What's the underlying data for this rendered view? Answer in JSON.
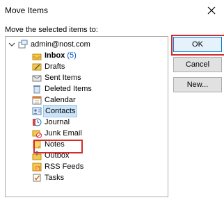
{
  "window": {
    "title": "Move Items"
  },
  "prompt": "Move the selected items to:",
  "tree": {
    "root": {
      "label": "admin@nost.com",
      "icon": "mailbox-icon"
    },
    "items": [
      {
        "label": "Inbox",
        "count": "(5)",
        "icon": "inbox-icon",
        "bold": true
      },
      {
        "label": "Drafts",
        "icon": "drafts-icon"
      },
      {
        "label": "Sent Items",
        "icon": "sent-items-icon"
      },
      {
        "label": "Deleted Items",
        "icon": "deleted-items-icon"
      },
      {
        "label": "Calendar",
        "icon": "calendar-icon"
      },
      {
        "label": "Contacts",
        "icon": "contacts-icon",
        "selected": true
      },
      {
        "label": "Journal",
        "icon": "journal-icon"
      },
      {
        "label": "Junk Email",
        "icon": "junk-email-icon"
      },
      {
        "label": "Notes",
        "icon": "notes-icon"
      },
      {
        "label": "Outbox",
        "icon": "outbox-icon"
      },
      {
        "label": "RSS Feeds",
        "icon": "rss-feeds-icon"
      },
      {
        "label": "Tasks",
        "icon": "tasks-icon"
      }
    ]
  },
  "buttons": {
    "ok": "OK",
    "cancel": "Cancel",
    "new": "New..."
  },
  "colors": {
    "highlight": "#d22b2b",
    "selection": "#cce4f7",
    "accent": "#0078d7"
  }
}
